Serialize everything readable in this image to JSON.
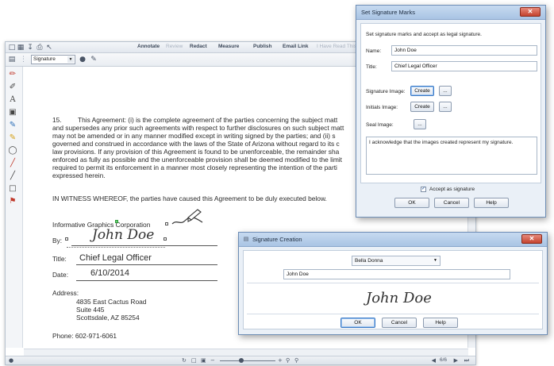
{
  "toolbar": {
    "menus": [
      {
        "label": "Annotate",
        "disabled": false
      },
      {
        "label": "Review",
        "disabled": true
      },
      {
        "label": "Redact",
        "disabled": false
      },
      {
        "label": "Measure",
        "disabled": false
      },
      {
        "label": "Publish",
        "disabled": false
      },
      {
        "label": "Email Link",
        "disabled": false
      },
      {
        "label": "I Have Read This",
        "disabled": true
      }
    ],
    "signature_select": "Signature"
  },
  "document": {
    "paragraph_number": "15.",
    "paragraph_lines": [
      "This Agreement:  (i) is the complete agreement of the parties concerning the subject matt",
      "and supersedes any prior such agreements with respect to further disclosures on such subject matt",
      "may not be amended or in any manner modified except in writing signed by the parties; and (ii) s",
      "governed and construed in accordance with the laws of the State of Arizona without regard to its c",
      "law provisions.  If any provision of this Agreement is found to be unenforceable, the remainder sha",
      "enforced as fully as possible and the unenforceable provision shall be deemed modified to the limit",
      "required to permit its enforcement in a manner most closely representing the intention of the parti",
      "expressed herein."
    ],
    "witness_line": "IN WITNESS WHEREOF, the parties have caused this Agreement to be duly executed below.",
    "company": "Informative Graphics Corporation",
    "by_label": "By:",
    "signature": "John Doe",
    "title_label": "Title:",
    "title_value": "Chief Legal Officer",
    "date_label": "Date:",
    "date_value": "6/10/2014",
    "address_label": "Address:",
    "address_lines": [
      "4835 East Cactus Road",
      "Suite 445",
      "Scottsdale, AZ 85254"
    ],
    "phone": "Phone:  602-971-6061"
  },
  "statusbar": {
    "page_readout": "6/6"
  },
  "sig_marks_dialog": {
    "title": "Set Signature Marks",
    "instructions": "Set signature marks and accept as legal signature.",
    "name_label": "Name:",
    "name_value": "John Doe",
    "title_label": "Title:",
    "title_value": "Chief Legal Officer",
    "sig_image_label": "Signature Image:",
    "initials_image_label": "Initials Image:",
    "seal_image_label": "Seal Image:",
    "create_label": "Create",
    "browse_label": "...",
    "acknowledge_text": "I acknowledge that the images created represent my signature.",
    "accept_label": "Accept as signature",
    "accept_checked": true,
    "ok_label": "OK",
    "cancel_label": "Cancel",
    "help_label": "Help"
  },
  "sig_creation_dialog": {
    "title": "Signature Creation",
    "font_select": "Bella Donna",
    "text_value": "John Doe",
    "preview_text": "John Doe",
    "ok_label": "OK",
    "cancel_label": "Cancel",
    "help_label": "Help"
  },
  "colors": {
    "accent": "#3b79c6",
    "title_bar": "#a9c4e4",
    "close_button": "#c4422e",
    "check_mark": "#1b4f9a"
  }
}
